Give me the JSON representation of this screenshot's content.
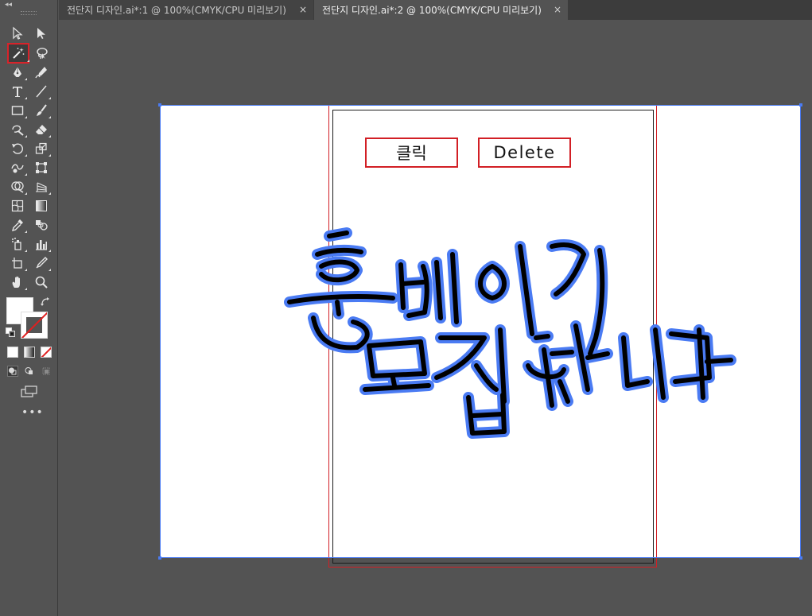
{
  "tabs": [
    {
      "label": "전단지 디자인.ai*:1 @ 100%(CMYK/CPU 미리보기)",
      "close": "×",
      "active": false
    },
    {
      "label": "전단지 디자인.ai*:2 @ 100%(CMYK/CPU 미리보기)",
      "close": "×",
      "active": true
    }
  ],
  "toolbar": {
    "collapse": "◂◂",
    "more": "•••",
    "active_tool": "magic-wand-tool",
    "colors": {
      "fill": "#ffffff",
      "stroke": "none",
      "none_indicator": "#e02020"
    }
  },
  "artboard": {
    "buttons": {
      "click": "클릭",
      "delete": "Delete"
    },
    "lettering_lines": [
      "홈베이킹",
      "모집합니다"
    ],
    "colors": {
      "selection": "#4a7bf3",
      "bleed": "#d21f25",
      "ink": "#000000",
      "outline": "#4a7bf3"
    }
  }
}
